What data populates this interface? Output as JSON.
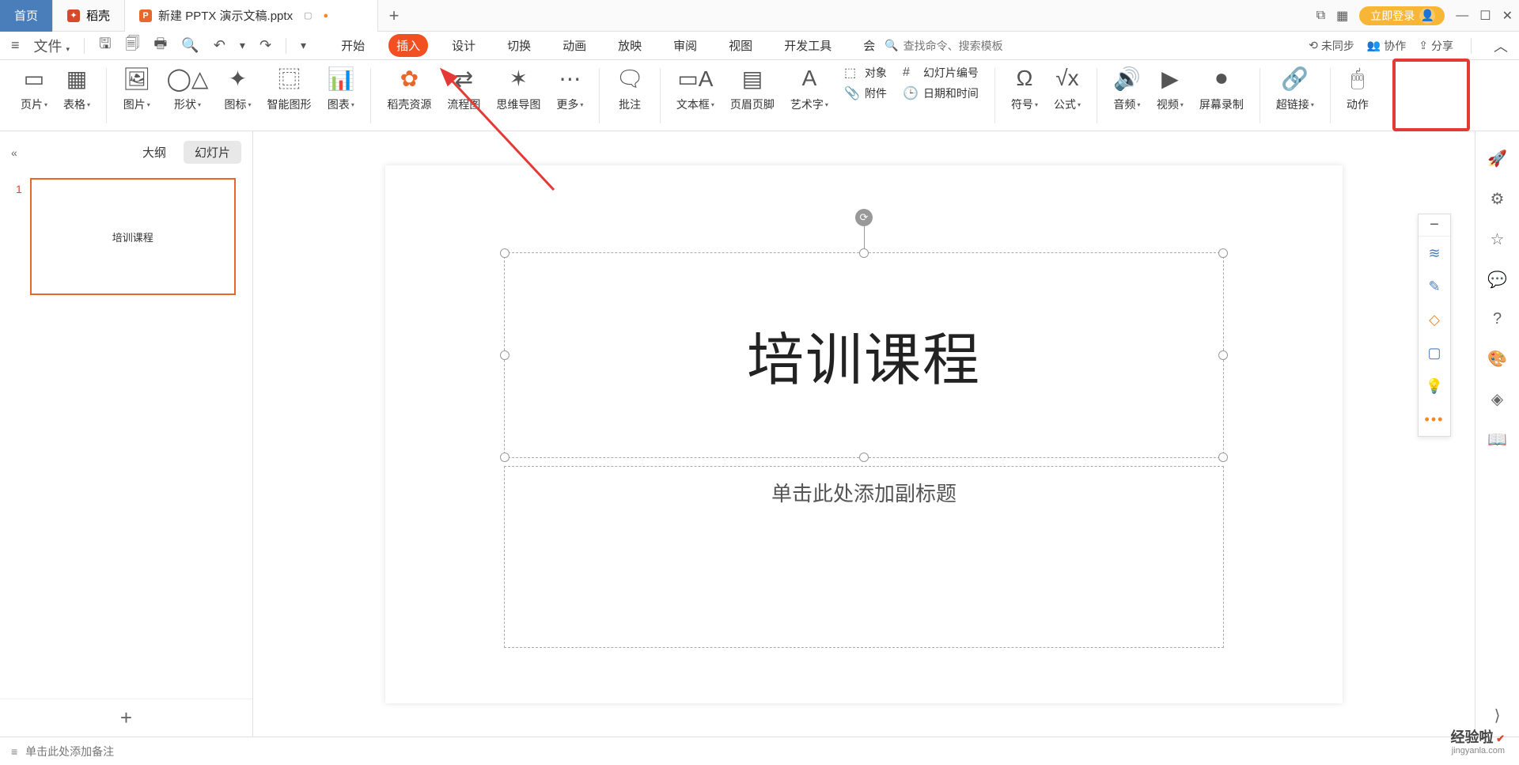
{
  "titlebar": {
    "home": "首页",
    "docks": "稻壳",
    "doc": "新建 PPTX 演示文稿.pptx",
    "new_tab": "+",
    "login": "立即登录"
  },
  "menubar": {
    "file": "文件",
    "tabs": [
      "开始",
      "插入",
      "设计",
      "切换",
      "动画",
      "放映",
      "审阅",
      "视图",
      "开发工具",
      "会"
    ],
    "active_tab_index": 1,
    "search_placeholder": "查找命令、搜索模板",
    "right": {
      "unsynced": "未同步",
      "collab": "协作",
      "share": "分享"
    }
  },
  "ribbon": {
    "slide": "页片",
    "table": "表格",
    "picture": "图片",
    "shape": "形状",
    "icon": "图标",
    "smartart": "智能图形",
    "chart": "图表",
    "res": "稻壳资源",
    "flow": "流程图",
    "mind": "思维导图",
    "more": "更多",
    "comment": "批注",
    "textbox": "文本框",
    "header": "页眉页脚",
    "wordart": "艺术字",
    "obj": "对象",
    "slidenum": "幻灯片编号",
    "attach": "附件",
    "datetime": "日期和时间",
    "symbol": "符号",
    "formula": "公式",
    "audio": "音频",
    "video": "视频",
    "screenrec": "屏幕录制",
    "hyperlink": "超链接",
    "action": "动作"
  },
  "leftpane": {
    "outline": "大纲",
    "slides": "幻灯片",
    "thumb_num": "1",
    "thumb_text": "培训课程",
    "add": "+"
  },
  "slide": {
    "title": "培训课程",
    "subtitle": "单击此处添加副标题"
  },
  "notesbar": {
    "placeholder": "单击此处添加备注"
  },
  "watermark": {
    "line1": "经验啦",
    "line2": "jingyanla.com"
  }
}
